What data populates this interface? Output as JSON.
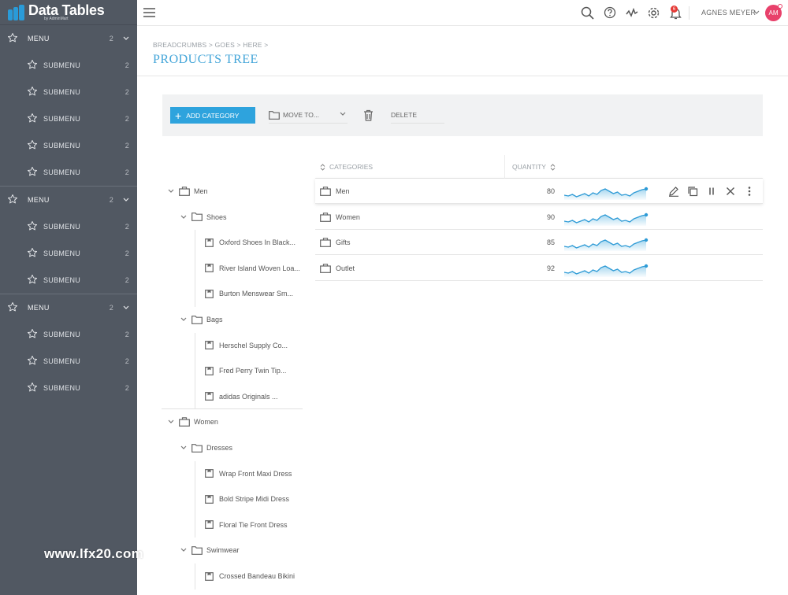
{
  "brand": {
    "title": "Data Tables",
    "subtitle": "by AdminMart"
  },
  "sidebar": {
    "groups": [
      {
        "label": "MENU",
        "count": "2",
        "items": [
          {
            "label": "SUBMENU",
            "count": "2"
          },
          {
            "label": "SUBMENU",
            "count": "2"
          },
          {
            "label": "SUBMENU",
            "count": "2"
          },
          {
            "label": "SUBMENU",
            "count": "2"
          },
          {
            "label": "SUBMENU",
            "count": "2"
          }
        ]
      },
      {
        "label": "MENU",
        "count": "2",
        "items": [
          {
            "label": "SUBMENU",
            "count": "2"
          },
          {
            "label": "SUBMENU",
            "count": "2"
          },
          {
            "label": "SUBMENU",
            "count": "2"
          }
        ]
      },
      {
        "label": "MENU",
        "count": "2",
        "items": [
          {
            "label": "SUBMENU",
            "count": "2"
          },
          {
            "label": "SUBMENU",
            "count": "2"
          },
          {
            "label": "SUBMENU",
            "count": "2"
          }
        ]
      }
    ]
  },
  "topbar": {
    "user_name": "AGNES MEYER",
    "avatar_initials": "AM",
    "notifications": "6"
  },
  "header": {
    "breadcrumb": "BREADCRUMBS > GOES > HERE >",
    "title": "PRODUCTS TREE"
  },
  "toolbar": {
    "add_label": "ADD CATEGORY",
    "move_label": "MOVE TO...",
    "delete_label": "DELETE"
  },
  "tree": {
    "nodes": [
      {
        "label": "Men",
        "level": 0,
        "type": "category"
      },
      {
        "label": "Shoes",
        "level": 1,
        "type": "folder"
      },
      {
        "label": "Oxford Shoes In Black...",
        "level": 2,
        "type": "item"
      },
      {
        "label": "River Island Woven Loa...",
        "level": 2,
        "type": "item"
      },
      {
        "label": "Burton Menswear Sm...",
        "level": 2,
        "type": "item"
      },
      {
        "label": "Bags",
        "level": 1,
        "type": "folder"
      },
      {
        "label": "Herschel Supply Co...",
        "level": 2,
        "type": "item"
      },
      {
        "label": "Fred Perry Twin Tip...",
        "level": 2,
        "type": "item"
      },
      {
        "label": "adidas Originals ...",
        "level": 2,
        "type": "item"
      },
      {
        "label": "Women",
        "level": 0,
        "type": "category"
      },
      {
        "label": "Dresses",
        "level": 1,
        "type": "folder"
      },
      {
        "label": "Wrap Front Maxi Dress",
        "level": 2,
        "type": "item"
      },
      {
        "label": "Bold Stripe Midi Dress",
        "level": 2,
        "type": "item"
      },
      {
        "label": "Floral Tie Front Dress",
        "level": 2,
        "type": "item"
      },
      {
        "label": "Swimwear",
        "level": 1,
        "type": "folder"
      },
      {
        "label": "Crossed Bandeau Bikini",
        "level": 2,
        "type": "item"
      }
    ]
  },
  "table": {
    "columns": {
      "categories": "CATEGORIES",
      "quantity": "QUANTITY"
    },
    "rows": [
      {
        "category": "Men",
        "quantity": "80"
      },
      {
        "category": "Women",
        "quantity": "90"
      },
      {
        "category": "Gifts",
        "quantity": "85"
      },
      {
        "category": "Outlet",
        "quantity": "92"
      }
    ]
  },
  "watermark": "www.lfx20.com",
  "colors": {
    "accent": "#2ea3dd",
    "sidebar": "#515862",
    "title": "#45a6d9",
    "danger": "#e53935",
    "avatar": "#e8416b"
  }
}
